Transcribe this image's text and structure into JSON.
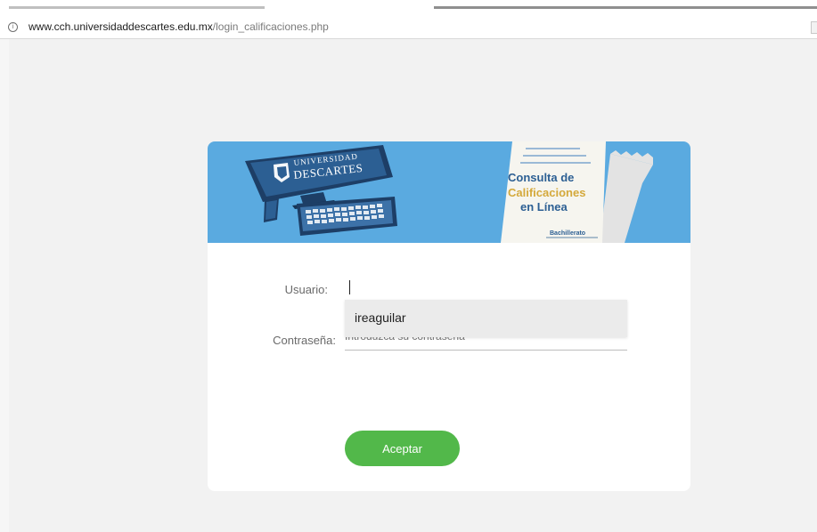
{
  "browser": {
    "url_domain": "www.cch.universidaddescartes.edu.mx",
    "url_path": "/login_calificaciones.php",
    "info_icon": "info-icon"
  },
  "banner": {
    "logo_line1": "UNIVERSIDAD",
    "logo_line2": "DESCARTES",
    "doc_line1": "Consulta de",
    "doc_line2": "Calificaciones",
    "doc_line3": "en Línea",
    "doc_footer": "Bachillerato"
  },
  "form": {
    "user_label": "Usuario:",
    "user_value": "",
    "pass_label": "Contraseña:",
    "pass_placeholder": "Introduzca su contraseña",
    "autofill_suggestion": "ireaguilar",
    "submit_label": "Aceptar"
  },
  "colors": {
    "banner_bg": "#5aaae0",
    "accent_green": "#52b84a",
    "page_bg": "#f2f2f2"
  }
}
